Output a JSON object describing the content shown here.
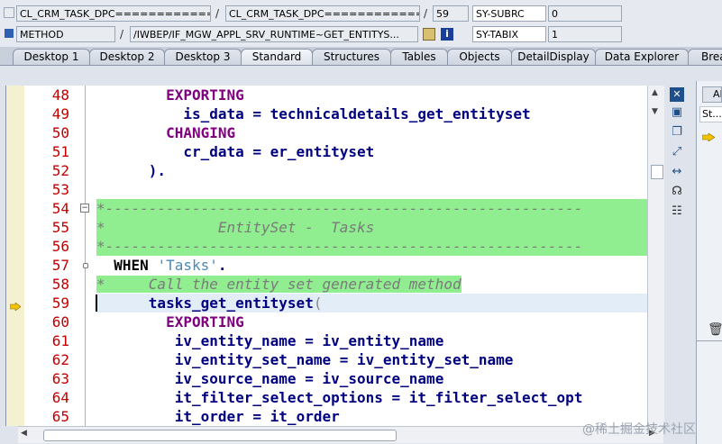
{
  "header": {
    "row1": {
      "program": "CL_CRM_TASK_DPC==============",
      "include": "CL_CRM_TASK_DPC==============",
      "line": "59",
      "var_name": "SY-SUBRC",
      "var_value": "0"
    },
    "row2": {
      "type": "METHOD",
      "method": "/IWBEP/IF_MGW_APPL_SRV_RUNTIME~GET_ENTITYS...",
      "var_name": "SY-TABIX",
      "var_value": "1"
    },
    "separator": "/"
  },
  "tabs": [
    {
      "label": "Desktop 1"
    },
    {
      "label": "Desktop 2"
    },
    {
      "label": "Desktop 3"
    },
    {
      "label": "Standard",
      "active": true
    },
    {
      "label": "Structures"
    },
    {
      "label": "Tables"
    },
    {
      "label": "Objects"
    },
    {
      "label": "DetailDisplay"
    },
    {
      "label": "Data Explorer"
    },
    {
      "label": "Brea"
    }
  ],
  "editor": {
    "lines": [
      {
        "num": "48",
        "text": "        EXPORTING"
      },
      {
        "num": "49",
        "text": "          is_data = technicaldetails_get_entityset"
      },
      {
        "num": "50",
        "text": "        CHANGING"
      },
      {
        "num": "51",
        "text": "          cr_data = er_entityset"
      },
      {
        "num": "52",
        "text": "      )."
      },
      {
        "num": "53",
        "text": ""
      },
      {
        "num": "54",
        "text": "*-------------------------------------------------------"
      },
      {
        "num": "55",
        "text": "*             EntitySet -  Tasks"
      },
      {
        "num": "56",
        "text": "*-------------------------------------------------------"
      },
      {
        "num": "57",
        "text": "  WHEN 'Tasks'."
      },
      {
        "num": "58",
        "text": "*     Call the entity set generated method"
      },
      {
        "num": "59",
        "text": "      tasks_get_entityset("
      },
      {
        "num": "60",
        "text": "        EXPORTING"
      },
      {
        "num": "61",
        "text": "         iv_entity_name = iv_entity_name"
      },
      {
        "num": "62",
        "text": "         iv_entity_set_name = iv_entity_set_name"
      },
      {
        "num": "63",
        "text": "         iv_source_name = iv_source_name"
      },
      {
        "num": "64",
        "text": "         it_filter_select_options = it_filter_select_opt"
      },
      {
        "num": "65",
        "text": "         it_order = it_order"
      }
    ]
  },
  "right_panel": {
    "col_header": "AB",
    "cell": "St..."
  },
  "watermark": "@稀土掘金技术社区",
  "icons": [
    "close-icon",
    "new-icon",
    "copy-icon",
    "expand-icon",
    "arrows-icon",
    "headset-icon",
    "tree-icon",
    "debug-arrow-icon",
    "trash-icon",
    "scroll-up-icon",
    "scroll-down-icon"
  ]
}
